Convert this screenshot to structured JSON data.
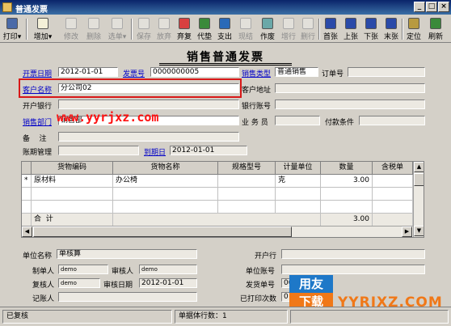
{
  "window": {
    "title": "普通发票"
  },
  "toolbar": [
    {
      "label": "打印",
      "icon": "printer-icon",
      "enabled": true,
      "color": "#4a6aa8"
    },
    {
      "label": "增加",
      "icon": "add-document-icon",
      "enabled": true,
      "color": "#f4f0d8"
    },
    {
      "label": "修改",
      "icon": "edit-icon",
      "enabled": false,
      "color": "#cccccc"
    },
    {
      "label": "删除",
      "icon": "delete-icon",
      "enabled": false,
      "color": "#cccccc"
    },
    {
      "label": "选单",
      "icon": "select-list-icon",
      "enabled": false,
      "color": "#cccccc"
    },
    {
      "label": "保存",
      "icon": "save-icon",
      "enabled": false,
      "color": "#cccccc"
    },
    {
      "label": "放弃",
      "icon": "cancel-icon",
      "enabled": false,
      "color": "#cccccc"
    },
    {
      "label": "弃复",
      "icon": "review-icon",
      "enabled": true,
      "color": "#d84040"
    },
    {
      "label": "代垫",
      "icon": "advance-payment-icon",
      "enabled": true,
      "color": "#3a8a3a"
    },
    {
      "label": "支出",
      "icon": "expense-icon",
      "enabled": true,
      "color": "#2a6ab8"
    },
    {
      "label": "现结",
      "icon": "cash-settle-icon",
      "enabled": false,
      "color": "#cccccc"
    },
    {
      "label": "作废",
      "icon": "void-icon",
      "enabled": true,
      "color": "#6aa8a8"
    },
    {
      "label": "增行",
      "icon": "add-row-icon",
      "enabled": false,
      "color": "#cccccc"
    },
    {
      "label": "删行",
      "icon": "delete-row-icon",
      "enabled": false,
      "color": "#cccccc"
    },
    {
      "label": "首张",
      "icon": "first-record-icon",
      "enabled": true,
      "color": "#2a4aa8"
    },
    {
      "label": "上张",
      "icon": "previous-record-icon",
      "enabled": true,
      "color": "#2a4aa8"
    },
    {
      "label": "下张",
      "icon": "next-record-icon",
      "enabled": true,
      "color": "#2a4aa8"
    },
    {
      "label": "末张",
      "icon": "last-record-icon",
      "enabled": true,
      "color": "#2a4aa8"
    },
    {
      "label": "定位",
      "icon": "locate-icon",
      "enabled": true,
      "color": "#b89a40"
    },
    {
      "label": "刷新",
      "icon": "refresh-icon",
      "enabled": true,
      "color": "#3a8a3a"
    }
  ],
  "form": {
    "title": "销售普通发票",
    "invoice_date_label": "开票日期",
    "invoice_date": "2012-01-01",
    "invoice_no_label": "发票号",
    "invoice_no": "0000000005",
    "sales_type_label": "销售类型",
    "sales_type": "普通销售",
    "order_no_label": "订单号",
    "order_no": "",
    "customer_label": "客户名称",
    "customer": "分公司02",
    "customer_address_label": "客户地址",
    "customer_address": "",
    "bank_label": "开户银行",
    "bank": "",
    "bank_account_label": "银行账号",
    "bank_account": "",
    "department_label": "销售部门",
    "department": "销售部",
    "salesperson_label": "业 务 员",
    "salesperson": "",
    "payment_terms_label": "付款条件",
    "payment_terms": "",
    "remarks_label": "备    注",
    "remarks": "",
    "account_mgmt_label": "账期管理",
    "account_mgmt": "",
    "due_date_label": "到期日",
    "due_date": "2012-01-01"
  },
  "grid": {
    "columns": [
      "",
      "货物编码",
      "货物名称",
      "规格型号",
      "计量单位",
      "数量",
      "含税单"
    ],
    "rows": [
      {
        "marker": "*",
        "code": "原材料",
        "name": "办公椅",
        "spec": "",
        "unit": "克",
        "qty": "3.00",
        "price": ""
      }
    ],
    "total_label": "合  计",
    "total_qty": "3.00"
  },
  "footer": {
    "company_label": "单位名称",
    "company": "单核算",
    "opening_bank_label": "开户行",
    "opening_bank": "",
    "maker_label": "制单人",
    "maker": "demo",
    "auditor_label": "审核人",
    "auditor": "demo",
    "company_account_label": "单位账号",
    "company_account": "",
    "reviewer_label": "复核人",
    "reviewer": "demo",
    "review_date_label": "审核日期",
    "review_date": "2012-01-01",
    "shipment_no_label": "发货单号",
    "shipment_no": "0000000005",
    "bookkeeper_label": "记账人",
    "bookkeeper": "",
    "printed_count_label": "已打印次数",
    "printed_count": "0"
  },
  "status": {
    "state": "已复核",
    "rows_text": "单据体行数：1"
  },
  "watermark": {
    "text": "www.yyrjxz.com",
    "logo_top": "用友",
    "logo_bottom": "下载",
    "brand": "YYRJXZ.COM"
  }
}
